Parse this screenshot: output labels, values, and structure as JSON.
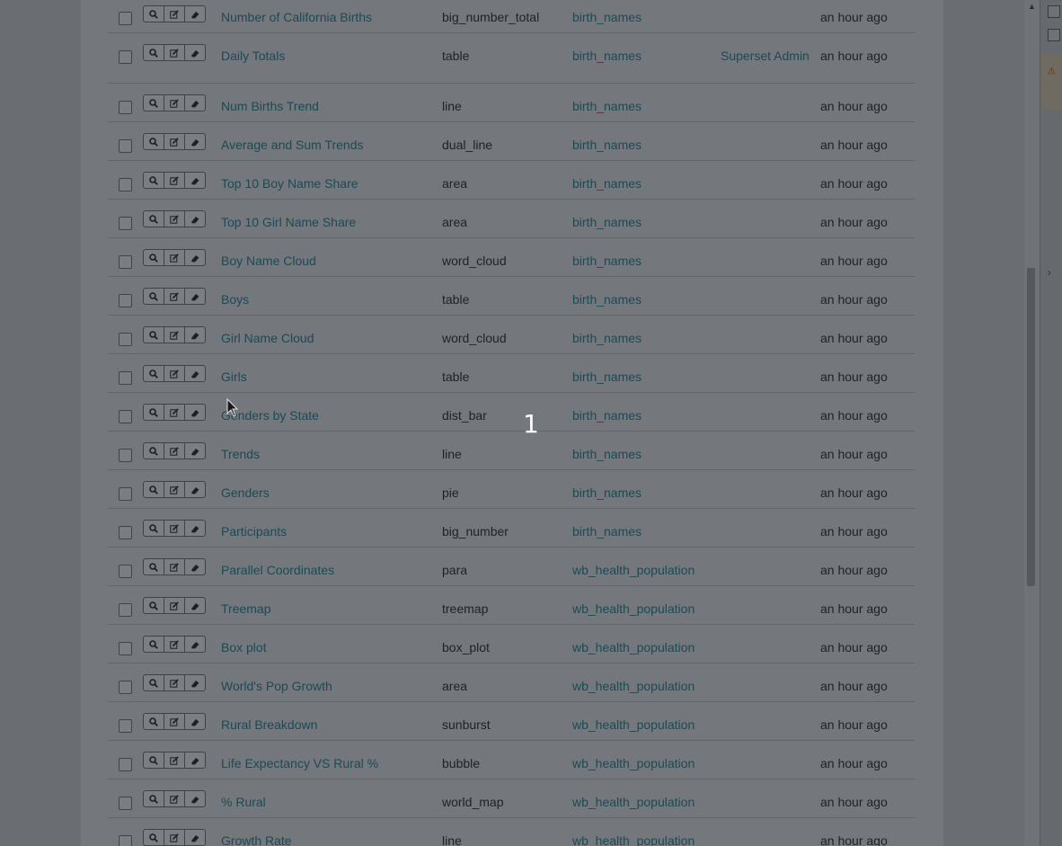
{
  "table": {
    "rows": [
      {
        "name": "",
        "viz_type": "",
        "datasource": "",
        "owner": "",
        "modified": ""
      },
      {
        "name": "Number of California Births",
        "viz_type": "big_number_total",
        "datasource": "birth_names",
        "owner": "",
        "modified": "an hour ago"
      },
      {
        "name": "Daily Totals",
        "viz_type": "table",
        "datasource": "birth_names",
        "owner": "Superset Admin",
        "modified": "an hour ago"
      },
      {
        "name": "Num Births Trend",
        "viz_type": "line",
        "datasource": "birth_names",
        "owner": "",
        "modified": "an hour ago"
      },
      {
        "name": "Average and Sum Trends",
        "viz_type": "dual_line",
        "datasource": "birth_names",
        "owner": "",
        "modified": "an hour ago"
      },
      {
        "name": "Top 10 Boy Name Share",
        "viz_type": "area",
        "datasource": "birth_names",
        "owner": "",
        "modified": "an hour ago"
      },
      {
        "name": "Top 10 Girl Name Share",
        "viz_type": "area",
        "datasource": "birth_names",
        "owner": "",
        "modified": "an hour ago"
      },
      {
        "name": "Boy Name Cloud",
        "viz_type": "word_cloud",
        "datasource": "birth_names",
        "owner": "",
        "modified": "an hour ago"
      },
      {
        "name": "Boys",
        "viz_type": "table",
        "datasource": "birth_names",
        "owner": "",
        "modified": "an hour ago"
      },
      {
        "name": "Girl Name Cloud",
        "viz_type": "word_cloud",
        "datasource": "birth_names",
        "owner": "",
        "modified": "an hour ago"
      },
      {
        "name": "Girls",
        "viz_type": "table",
        "datasource": "birth_names",
        "owner": "",
        "modified": "an hour ago"
      },
      {
        "name": "Genders by State",
        "viz_type": "dist_bar",
        "datasource": "birth_names",
        "owner": "",
        "modified": "an hour ago"
      },
      {
        "name": "Trends",
        "viz_type": "line",
        "datasource": "birth_names",
        "owner": "",
        "modified": "an hour ago"
      },
      {
        "name": "Genders",
        "viz_type": "pie",
        "datasource": "birth_names",
        "owner": "",
        "modified": "an hour ago"
      },
      {
        "name": "Participants",
        "viz_type": "big_number",
        "datasource": "birth_names",
        "owner": "",
        "modified": "an hour ago"
      },
      {
        "name": "Parallel Coordinates",
        "viz_type": "para",
        "datasource": "wb_health_population",
        "owner": "",
        "modified": "an hour ago"
      },
      {
        "name": "Treemap",
        "viz_type": "treemap",
        "datasource": "wb_health_population",
        "owner": "",
        "modified": "an hour ago"
      },
      {
        "name": "Box plot",
        "viz_type": "box_plot",
        "datasource": "wb_health_population",
        "owner": "",
        "modified": "an hour ago"
      },
      {
        "name": "World's Pop Growth",
        "viz_type": "area",
        "datasource": "wb_health_population",
        "owner": "",
        "modified": "an hour ago"
      },
      {
        "name": "Rural Breakdown",
        "viz_type": "sunburst",
        "datasource": "wb_health_population",
        "owner": "",
        "modified": "an hour ago"
      },
      {
        "name": "Life Expectancy VS Rural %",
        "viz_type": "bubble",
        "datasource": "wb_health_population",
        "owner": "",
        "modified": "an hour ago"
      },
      {
        "name": "% Rural",
        "viz_type": "world_map",
        "datasource": "wb_health_population",
        "owner": "",
        "modified": "an hour ago"
      },
      {
        "name": "Growth Rate",
        "viz_type": "line",
        "datasource": "wb_health_population",
        "owner": "",
        "modified": "an hour ago"
      }
    ]
  },
  "action_icons": [
    "search-icon",
    "edit-icon",
    "eraser-icon"
  ],
  "overlay": {
    "step_marker": "1"
  },
  "colors": {
    "link": "#1b4a55",
    "text": "#1f2124",
    "backdrop": "#6a6d72"
  }
}
